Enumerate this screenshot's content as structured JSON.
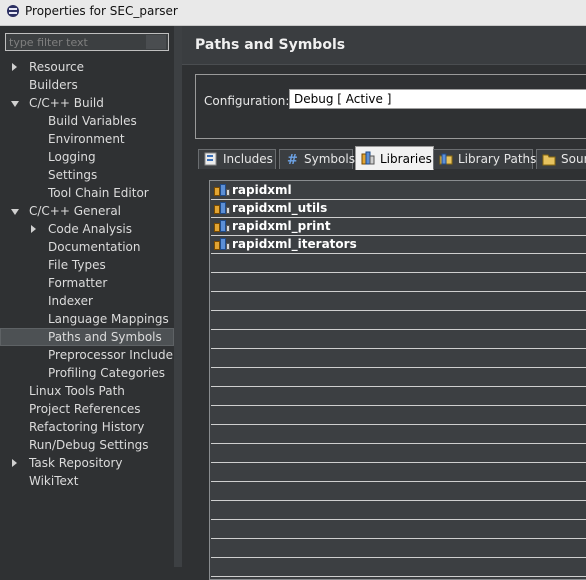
{
  "window": {
    "title": "Properties for SEC_parser"
  },
  "filter": {
    "placeholder": "type filter text"
  },
  "nav": {
    "items": [
      {
        "label": "Resource",
        "level": 0,
        "twist": "closed"
      },
      {
        "label": "Builders",
        "level": 0,
        "twist": "none"
      },
      {
        "label": "C/C++ Build",
        "level": 0,
        "twist": "open"
      },
      {
        "label": "Build Variables",
        "level": 1,
        "twist": "none"
      },
      {
        "label": "Environment",
        "level": 1,
        "twist": "none"
      },
      {
        "label": "Logging",
        "level": 1,
        "twist": "none"
      },
      {
        "label": "Settings",
        "level": 1,
        "twist": "none"
      },
      {
        "label": "Tool Chain Editor",
        "level": 1,
        "twist": "none"
      },
      {
        "label": "C/C++ General",
        "level": 0,
        "twist": "open"
      },
      {
        "label": "Code Analysis",
        "level": 1,
        "twist": "closed"
      },
      {
        "label": "Documentation",
        "level": 1,
        "twist": "none"
      },
      {
        "label": "File Types",
        "level": 1,
        "twist": "none"
      },
      {
        "label": "Formatter",
        "level": 1,
        "twist": "none"
      },
      {
        "label": "Indexer",
        "level": 1,
        "twist": "none"
      },
      {
        "label": "Language Mappings",
        "level": 1,
        "twist": "none"
      },
      {
        "label": "Paths and Symbols",
        "level": 1,
        "twist": "none",
        "selected": true
      },
      {
        "label": "Preprocessor Include Pa",
        "level": 1,
        "twist": "none"
      },
      {
        "label": "Profiling Categories",
        "level": 1,
        "twist": "none"
      },
      {
        "label": "Linux Tools Path",
        "level": 0,
        "twist": "none"
      },
      {
        "label": "Project References",
        "level": 0,
        "twist": "none"
      },
      {
        "label": "Refactoring History",
        "level": 0,
        "twist": "none"
      },
      {
        "label": "Run/Debug Settings",
        "level": 0,
        "twist": "none"
      },
      {
        "label": "Task Repository",
        "level": 0,
        "twist": "closed"
      },
      {
        "label": "WikiText",
        "level": 0,
        "twist": "none"
      }
    ]
  },
  "page": {
    "title": "Paths and Symbols",
    "configuration_label": "Configuration:",
    "configuration_value": "Debug  [ Active ]"
  },
  "tabs": [
    {
      "label": "Includes",
      "icon": "includes-icon",
      "active": false
    },
    {
      "label": "Symbols",
      "icon": "hash-icon",
      "active": false
    },
    {
      "label": "Libraries",
      "icon": "library-icon",
      "active": true
    },
    {
      "label": "Library Paths",
      "icon": "library-path-icon",
      "active": false
    },
    {
      "label": "Sour",
      "icon": "source-folder-icon",
      "active": false
    }
  ],
  "libraries": [
    {
      "name": "rapidxml"
    },
    {
      "name": "rapidxml_utils"
    },
    {
      "name": "rapidxml_print"
    },
    {
      "name": "rapidxml_iterators"
    }
  ],
  "colors": {
    "background": "#2f3133",
    "selected_row": "#4d5154",
    "active_tab": "#f2f2f2"
  }
}
